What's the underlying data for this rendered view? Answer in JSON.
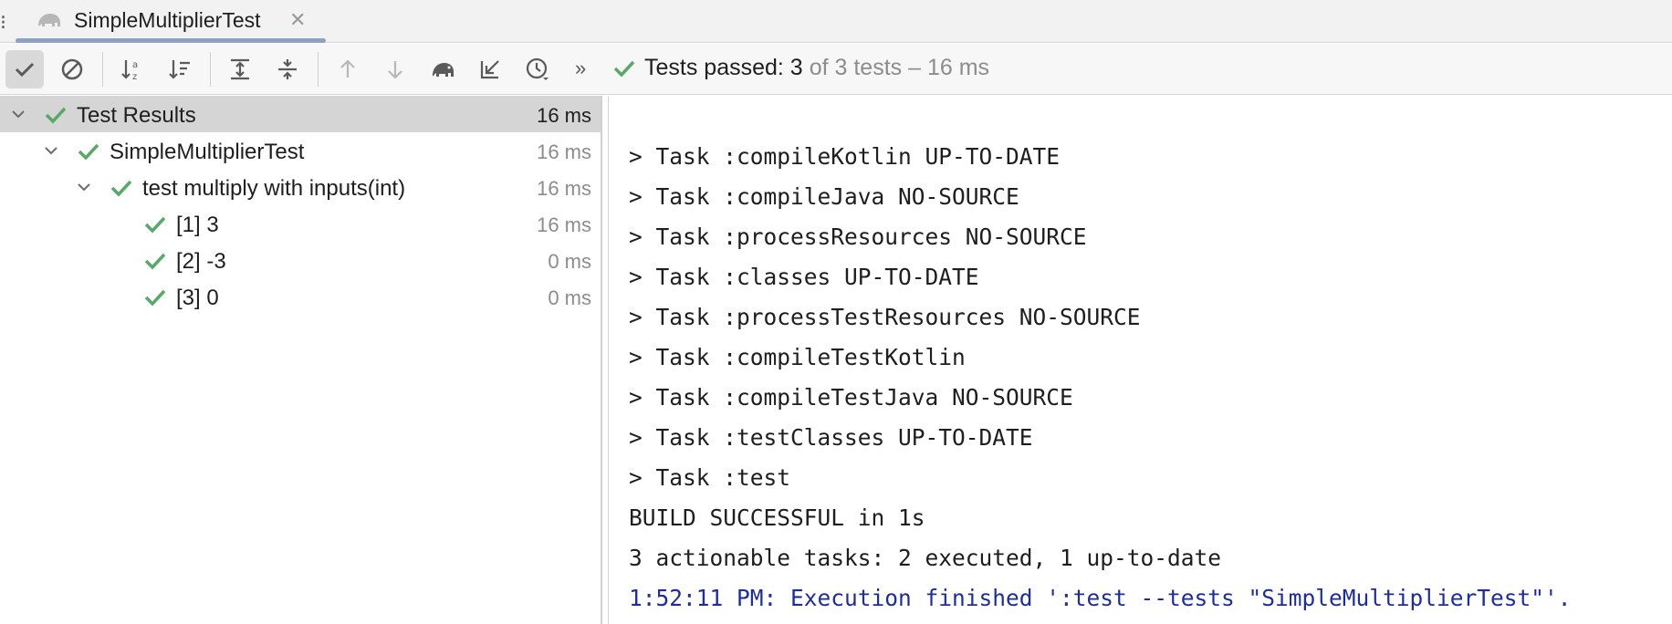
{
  "tab": {
    "title": "SimpleMultiplierTest",
    "close_glyph": "✕",
    "icon": "gradle-elephant-icon"
  },
  "toolbar": {
    "buttons": [
      {
        "name": "show-passed-button",
        "icon": "check-icon",
        "active": true
      },
      {
        "name": "show-ignored-button",
        "icon": "circle-slash-icon",
        "active": false
      },
      {
        "name": "sort-alphabetically-button",
        "icon": "sort-alpha-icon",
        "active": false
      },
      {
        "name": "sort-by-duration-button",
        "icon": "sort-duration-icon",
        "active": false
      },
      {
        "name": "expand-all-button",
        "icon": "expand-all-icon",
        "active": false
      },
      {
        "name": "collapse-all-button",
        "icon": "collapse-all-icon",
        "active": false
      },
      {
        "name": "previous-failed-button",
        "icon": "arrow-up-icon",
        "active": false
      },
      {
        "name": "next-failed-button",
        "icon": "arrow-down-icon",
        "active": false
      },
      {
        "name": "open-gradle-config-button",
        "icon": "elephant-icon",
        "active": false
      },
      {
        "name": "import-tests-button",
        "icon": "import-icon",
        "active": false
      },
      {
        "name": "test-history-button",
        "icon": "history-clock-icon",
        "active": false
      }
    ],
    "more_glyph": "»",
    "status_passed": "Tests passed: 3",
    "status_total": "of 3 tests – 16 ms"
  },
  "tree": {
    "rows": [
      {
        "label": "Test Results",
        "time": "16 ms",
        "level": 0,
        "expanded": true
      },
      {
        "label": "SimpleMultiplierTest",
        "time": "16 ms",
        "level": 1,
        "expanded": true
      },
      {
        "label": "test multiply with inputs(int)",
        "time": "16 ms",
        "level": 2,
        "expanded": true
      },
      {
        "label": "[1] 3",
        "time": "16 ms",
        "level": 3
      },
      {
        "label": "[2] -3",
        "time": "0 ms",
        "level": 3
      },
      {
        "label": "[3] 0",
        "time": "0 ms",
        "level": 3
      }
    ]
  },
  "console": {
    "lines": [
      "> Task :compileKotlin UP-TO-DATE",
      "> Task :compileJava NO-SOURCE",
      "> Task :processResources NO-SOURCE",
      "> Task :classes UP-TO-DATE",
      "> Task :processTestResources NO-SOURCE",
      "> Task :compileTestKotlin",
      "> Task :compileTestJava NO-SOURCE",
      "> Task :testClasses UP-TO-DATE",
      "> Task :test",
      "BUILD SUCCESSFUL in 1s",
      "3 actionable tasks: 2 executed, 1 up-to-date"
    ],
    "exec_line": "1:52:11 PM: Execution finished ':test --tests \"SimpleMultiplierTest\"'."
  },
  "colors": {
    "success_green": "#59a869",
    "exec_blue": "#1f2f91",
    "selected_row": "#d5d5d5"
  }
}
